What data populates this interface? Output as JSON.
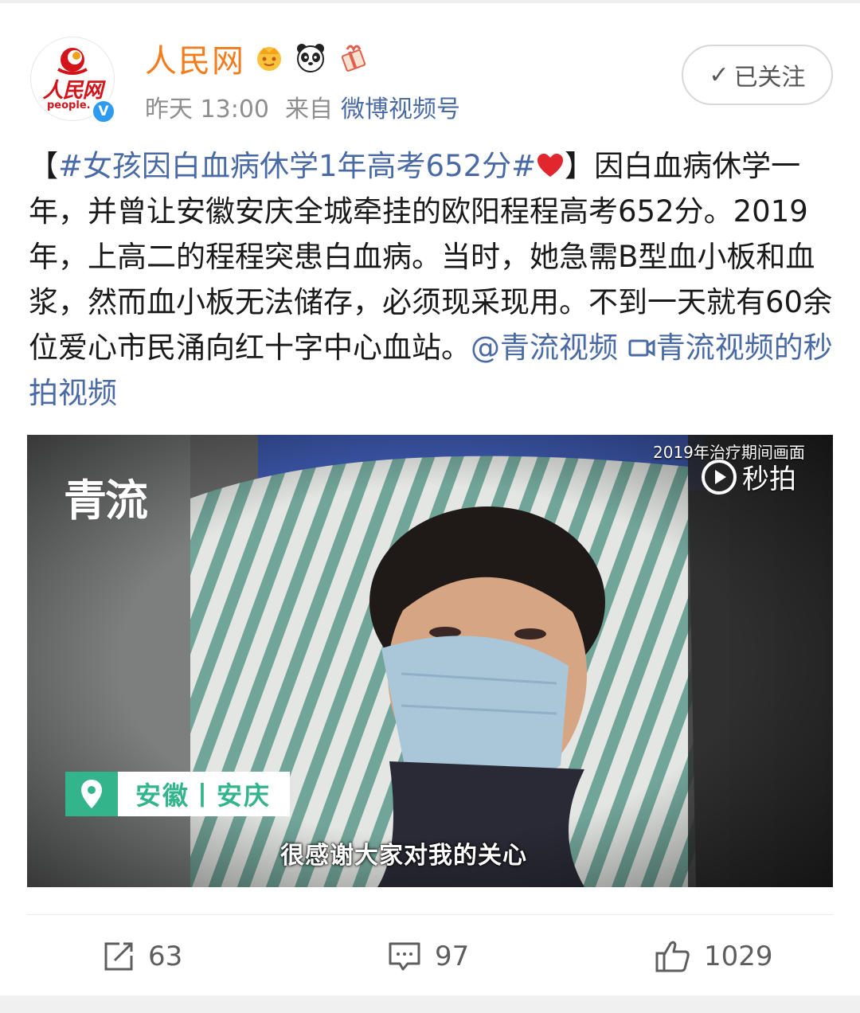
{
  "account": {
    "name": "人民网",
    "avatar_text_cn": "人民网",
    "avatar_text_en": "people.",
    "verified_mark": "V",
    "badges": [
      "crown-badge-icon",
      "panda-badge-icon",
      "gift-badge-icon"
    ]
  },
  "meta": {
    "time": "昨天 13:00",
    "from_label": "来自",
    "source": "微博视频号"
  },
  "follow_button": {
    "check": "✓",
    "label": "已关注"
  },
  "post": {
    "bracket_open": "【",
    "hashtag": "#女孩因白血病休学1年高考652分#",
    "bracket_close": "】",
    "body": "因白血病休学一年，并曾让安徽安庆全城牵挂的欧阳程程高考652分。2019年，上高二的程程突患白血病。当时，她急需B型血小板和血浆，然而血小板无法储存，必须现采现用。不到一天就有60余位爱心市民涌向红十字中心血站。",
    "mention": "@青流视频",
    "video_link_label": "青流视频的秒拍视频"
  },
  "video": {
    "logo_text": "青流",
    "overlay_text": "2019年治疗期间画面",
    "watermark": "秒拍",
    "location_label": "安徽丨安庆",
    "subtitle": "很感谢大家对我的关心"
  },
  "actions": {
    "repost_count": "63",
    "comment_count": "97",
    "like_count": "1029"
  },
  "colors": {
    "name": "#f37c1d",
    "link": "#4a6aa5",
    "location_green": "#33b48a",
    "verify_blue": "#2d9cf0"
  }
}
